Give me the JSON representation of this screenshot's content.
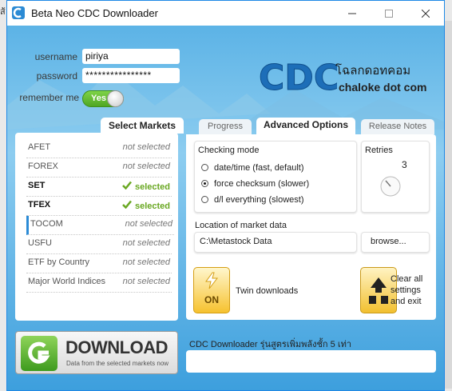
{
  "background": {
    "left_edge_text": "ส้"
  },
  "window": {
    "title": "Beta Neo CDC Downloader",
    "icon": "cdc-app-icon",
    "controls": [
      "minimize-icon",
      "maximize-icon",
      "close-icon"
    ]
  },
  "login": {
    "username_label": "username",
    "username_value": "piriya",
    "password_label": "password",
    "password_value": "****************",
    "remember_label": "remember me",
    "remember_toggle": "Yes",
    "remember_on": true
  },
  "logo": {
    "mark": "CDC",
    "thai_name": "โฉลกดอทคอม",
    "english_name": "chaloke dot com"
  },
  "markets": {
    "tab_label": "Select Markets",
    "items": [
      {
        "name": "AFET",
        "status": "not selected",
        "selected": false
      },
      {
        "name": "FOREX",
        "status": "not selected",
        "selected": false
      },
      {
        "name": "SET",
        "status": "selected",
        "selected": true
      },
      {
        "name": "TFEX",
        "status": "selected",
        "selected": true
      },
      {
        "name": "TOCOM",
        "status": "not selected",
        "selected": false
      },
      {
        "name": "USFU",
        "status": "not selected",
        "selected": false
      },
      {
        "name": "ETF by Country",
        "status": "not selected",
        "selected": false
      },
      {
        "name": "Major World Indices",
        "status": "not selected",
        "selected": false
      }
    ]
  },
  "tabs": [
    {
      "label": "Progress",
      "active": false
    },
    {
      "label": "Advanced Options",
      "active": true
    },
    {
      "label": "Release Notes",
      "active": false
    }
  ],
  "options": {
    "checking_mode_title": "Checking mode",
    "modes": [
      {
        "label": "date/time (fast, default)",
        "checked": false
      },
      {
        "label": "force checksum (slower)",
        "checked": true
      },
      {
        "label": "d/l everything (slowest)",
        "checked": false
      }
    ],
    "retries_title": "Retries",
    "retries_value": "3",
    "location_label": "Location of market data",
    "location_value": "C:\\Metastock Data",
    "browse_label": "browse...",
    "twin_label": "Twin downloads",
    "twin_toggle": "ON",
    "clear_label_1": "Clear all",
    "clear_label_2": "settings",
    "clear_label_3": "and exit"
  },
  "download": {
    "label": "DOWNLOAD",
    "sublabel": "Data from the selected markets now"
  },
  "status": {
    "text": "CDC Downloader รุ่นสูตรเพิ่มพลังชั้ก 5 เท่า",
    "value": ""
  },
  "colors": {
    "accent": "#1e88e5",
    "sky": "#5cb3e6",
    "selected_green": "#6aa823",
    "toggle_green": "#4fa623",
    "tile_yellow": "#f6c22f"
  }
}
